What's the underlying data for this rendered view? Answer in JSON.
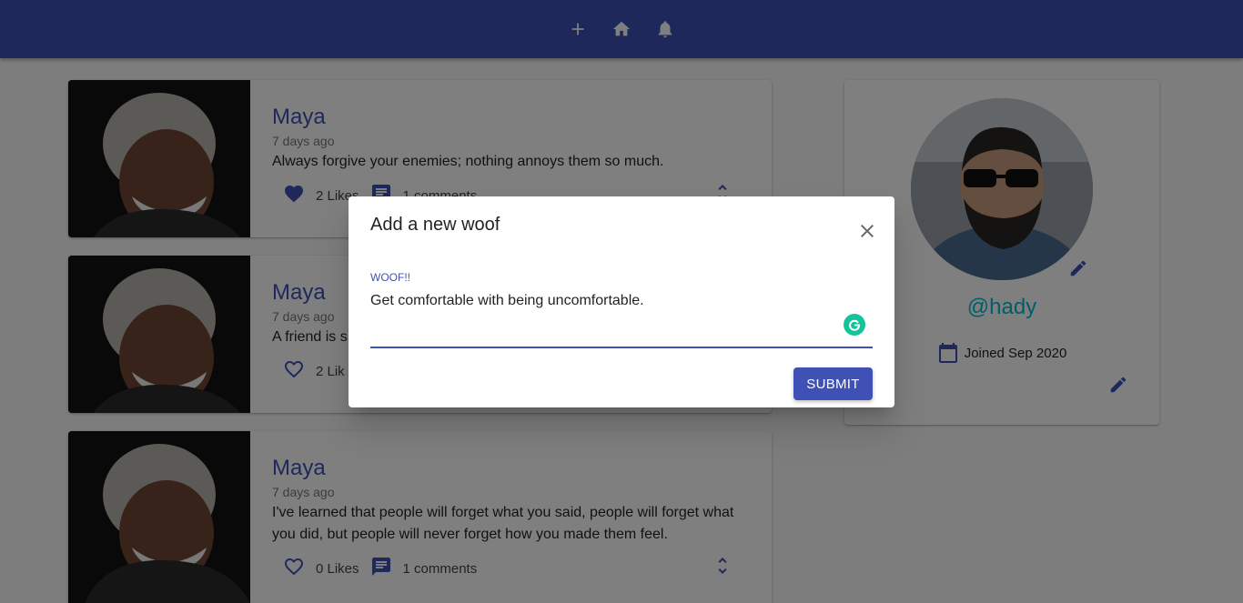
{
  "appbar": {
    "icons": [
      "add-icon",
      "home-icon",
      "notifications-icon"
    ]
  },
  "posts": [
    {
      "name": "Maya",
      "time": "7 days ago",
      "text": "Always forgive your enemies; nothing annoys them so much.",
      "likes": "2 Likes",
      "liked": true,
      "comments": "1 comments"
    },
    {
      "name": "Maya",
      "time": "7 days ago",
      "text": "A friend is s",
      "likes": "2 Lik",
      "liked": false,
      "comments": ""
    },
    {
      "name": "Maya",
      "time": "7 days ago",
      "text": "I've learned that people will forget what you said, people will forget what you did, but people will never forget how you made them feel.",
      "likes": "0 Likes",
      "liked": false,
      "comments": "1 comments"
    }
  ],
  "profile": {
    "handle": "@hady",
    "joined": "Joined Sep 2020"
  },
  "dialog": {
    "title": "Add a new woof",
    "field_label": "WOOF!!",
    "field_value": "Get comfortable with being uncomfortable.",
    "submit_label": "SUBMIT"
  },
  "colors": {
    "primary": "#3f51b5",
    "secondary": "#00bcd4",
    "grammarly": "#15c39a"
  }
}
